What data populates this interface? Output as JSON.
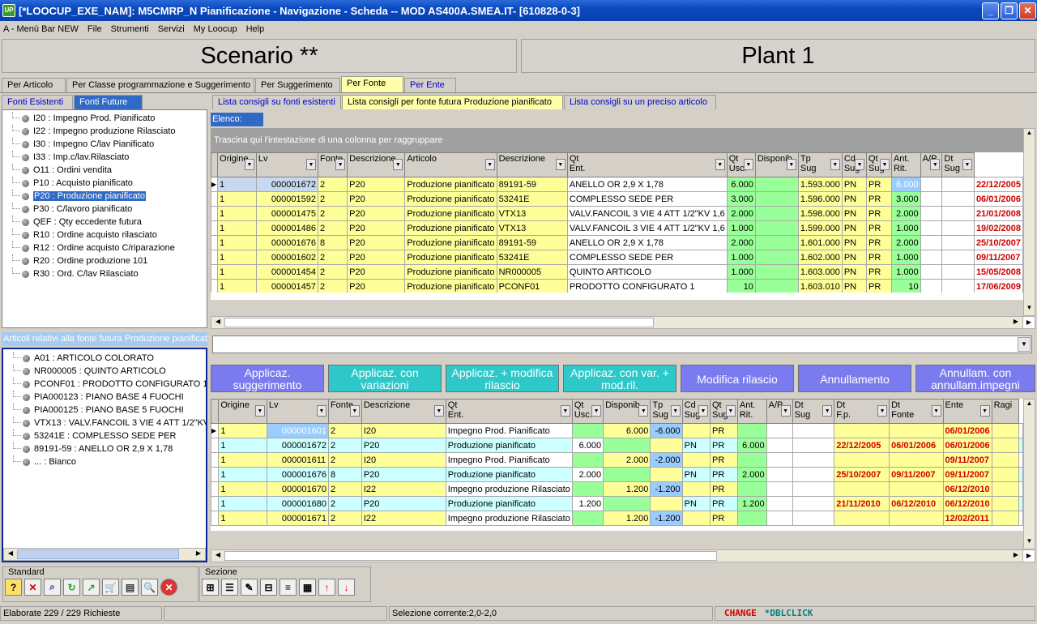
{
  "window": {
    "title": "[*LOOCUP_EXE_NAM]: M5CMRP_N Pianificazione - Navigazione - Scheda -- MOD AS400A.SMEA.IT- [610828-0-3]",
    "icon": "UP"
  },
  "menu": [
    "A - Menù Bar NEW",
    "File",
    "Strumenti",
    "Servizi",
    "My Loocup",
    "Help"
  ],
  "header": {
    "scenario": "Scenario **",
    "plant": "Plant 1"
  },
  "main_tabs": [
    "Per Articolo",
    "Per Classe programmazione e Suggerimento",
    "Per Suggerimento",
    "Per Fonte",
    "Per Ente"
  ],
  "source_tabs": [
    "Fonti Esistenti",
    "Fonti Future"
  ],
  "list_tabs": [
    "Lista consigli su fonti esistenti",
    "Lista consigli per fonte futura Produzione pianificato",
    "Lista consigli su un preciso articolo"
  ],
  "sources": [
    "I20 : Impegno Prod. Pianificato",
    "I22 : Impegno produzione Rilasciato",
    "I30 : Impegno C/lav Pianificato",
    "I33 : Imp.c/lav.Rilasciato",
    "O11 : Ordini vendita",
    "P10 : Acquisto pianificato",
    "P20 : Produzione pianificato",
    "P30 : C/lavoro pianificato",
    "QEF : Qty eccedente futura",
    "R10 : Ordine acquisto rilasciato",
    "R12 : Ordine acquisto C/riparazione",
    "R20 : Ordine produzione 101",
    "R30 : Ord. C/lav Rilasciato"
  ],
  "articles_header": "Articoli relativi alla fonte futura Produzione pianificato",
  "articles": [
    "A01 : ARTICOLO COLORATO",
    "NR000005 : QUINTO ARTICOLO",
    "PCONF01 : PRODOTTO CONFIGURATO 1",
    "PIA000123 : PIANO BASE 4 FUOCHI",
    "PIA000125 : PIANO BASE 5 FUOCHI",
    "VTX13 : VALV.FANCOIL 3 VIE 4 ATT 1/2\"KV 1,6",
    "53241E : COMPLESSO SEDE PER",
    "89191-59 : ANELLO OR 2,9 X 1,78",
    "... : Bianco"
  ],
  "elenco_label": "Elenco:",
  "group_hint": "Trascina qui l'intestazione di una colonna per raggruppare",
  "grid1": {
    "columns": [
      "Origine",
      "Lv",
      "Fonte",
      "Descrizione",
      "Articolo",
      "Descrizione",
      "Qt Ent.",
      "Qt Usc.",
      "Disponib.",
      "Tp Sug",
      "Cd Sug",
      "Qt Sug",
      "Ant. Rit.",
      "A/P",
      "Dt Sug"
    ],
    "rows": [
      [
        "1",
        "000001672",
        "2",
        "P20",
        "Produzione pianificato",
        "89191-59",
        "ANELLO OR 2,9 X 1,78",
        "6.000",
        "",
        "1.593.000",
        "PN",
        "PR",
        "6.000",
        "",
        "",
        "22/12/2005"
      ],
      [
        "1",
        "000001592",
        "2",
        "P20",
        "Produzione pianificato",
        "53241E",
        "COMPLESSO SEDE PER",
        "3.000",
        "",
        "1.596.000",
        "PN",
        "PR",
        "3.000",
        "",
        "",
        "06/01/2006"
      ],
      [
        "1",
        "000001475",
        "2",
        "P20",
        "Produzione pianificato",
        "VTX13",
        "VALV.FANCOIL 3 VIE 4 ATT 1/2\"KV 1,6",
        "2.000",
        "",
        "1.598.000",
        "PN",
        "PR",
        "2.000",
        "",
        "",
        "21/01/2008"
      ],
      [
        "1",
        "000001486",
        "2",
        "P20",
        "Produzione pianificato",
        "VTX13",
        "VALV.FANCOIL 3 VIE 4 ATT 1/2\"KV 1,6",
        "1.000",
        "",
        "1.599.000",
        "PN",
        "PR",
        "1.000",
        "",
        "",
        "19/02/2008"
      ],
      [
        "1",
        "000001676",
        "8",
        "P20",
        "Produzione pianificato",
        "89191-59",
        "ANELLO OR 2,9 X 1,78",
        "2.000",
        "",
        "1.601.000",
        "PN",
        "PR",
        "2.000",
        "",
        "",
        "25/10/2007"
      ],
      [
        "1",
        "000001602",
        "2",
        "P20",
        "Produzione pianificato",
        "53241E",
        "COMPLESSO SEDE PER",
        "1.000",
        "",
        "1.602.000",
        "PN",
        "PR",
        "1.000",
        "",
        "",
        "09/11/2007"
      ],
      [
        "1",
        "000001454",
        "2",
        "P20",
        "Produzione pianificato",
        "NR000005",
        "QUINTO ARTICOLO",
        "1.000",
        "",
        "1.603.000",
        "PN",
        "PR",
        "1.000",
        "",
        "",
        "15/05/2008"
      ],
      [
        "1",
        "000001457",
        "2",
        "P20",
        "Produzione pianificato",
        "PCONF01",
        "PRODOTTO CONFIGURATO 1",
        "10",
        "",
        "1.603.010",
        "PN",
        "PR",
        "10",
        "",
        "",
        "17/06/2009"
      ]
    ]
  },
  "actions": [
    "Applicaz. suggerimento",
    "Applicaz. con variazioni",
    "Applicaz. + modifica rilascio",
    "Applicaz. con var. + mod.ril.",
    "Modifica rilascio",
    "Annullamento",
    "Annullam. con annullam.impegni"
  ],
  "grid2": {
    "columns": [
      "Origine",
      "Lv",
      "Fonte",
      "Descrizione",
      "Qt Ent.",
      "Qt Usc.",
      "Disponib.",
      "Tp Sug",
      "Cd Sug",
      "Qt Sug",
      "Ant. Rit.",
      "A/P",
      "Dt Sug",
      "Dt F.p.",
      "Dt Fonte",
      "Ente",
      "Ragi"
    ],
    "rows": [
      [
        "1",
        "000001601",
        "2",
        "I20",
        "Impegno Prod. Pianificato",
        "",
        "6.000",
        "-6.000",
        "",
        "PR",
        "",
        "",
        "",
        "",
        "",
        "06/01/2006"
      ],
      [
        "1",
        "000001672",
        "2",
        "P20",
        "Produzione pianificato",
        "6.000",
        "",
        "",
        "PN",
        "PR",
        "6.000",
        "",
        "",
        "22/12/2005",
        "06/01/2006",
        "06/01/2006"
      ],
      [
        "1",
        "000001611",
        "2",
        "I20",
        "Impegno Prod. Pianificato",
        "",
        "2.000",
        "-2.000",
        "",
        "PR",
        "",
        "",
        "",
        "",
        "",
        "09/11/2007"
      ],
      [
        "1",
        "000001676",
        "8",
        "P20",
        "Produzione pianificato",
        "2.000",
        "",
        "",
        "PN",
        "PR",
        "2.000",
        "",
        "",
        "25/10/2007",
        "09/11/2007",
        "09/11/2007"
      ],
      [
        "1",
        "000001670",
        "2",
        "I22",
        "Impegno produzione Rilasciato",
        "",
        "1.200",
        "-1.200",
        "",
        "PR",
        "",
        "",
        "",
        "",
        "",
        "06/12/2010"
      ],
      [
        "1",
        "000001680",
        "2",
        "P20",
        "Produzione pianificato",
        "1.200",
        "",
        "",
        "PN",
        "PR",
        "1.200",
        "",
        "",
        "21/11/2010",
        "06/12/2010",
        "06/12/2010"
      ],
      [
        "1",
        "000001671",
        "2",
        "I22",
        "Impegno produzione Rilasciato",
        "",
        "1.200",
        "-1.200",
        "",
        "PR",
        "",
        "",
        "",
        "",
        "",
        "12/02/2011"
      ]
    ]
  },
  "toolbar": {
    "standard_label": "Standard",
    "sezione_label": "Sezione",
    "standard_icons": [
      "help-icon",
      "close-red-icon",
      "search-icon",
      "refresh-icon",
      "arrow-icon",
      "cart-icon",
      "export-icon",
      "zoom-icon",
      "stop-icon"
    ],
    "sezione_icons": [
      "tree-icon",
      "list-icon",
      "edit-icon",
      "tree-add-icon",
      "list-one-icon",
      "form-icon",
      "up-red-icon",
      "down-red-icon"
    ]
  },
  "status": {
    "left": "Elaborate 229 / 229 Richieste",
    "selection": "Selezione corrente:2,0-2,0",
    "change": "CHANGE",
    "dblclick": "*DBLCLICK"
  }
}
